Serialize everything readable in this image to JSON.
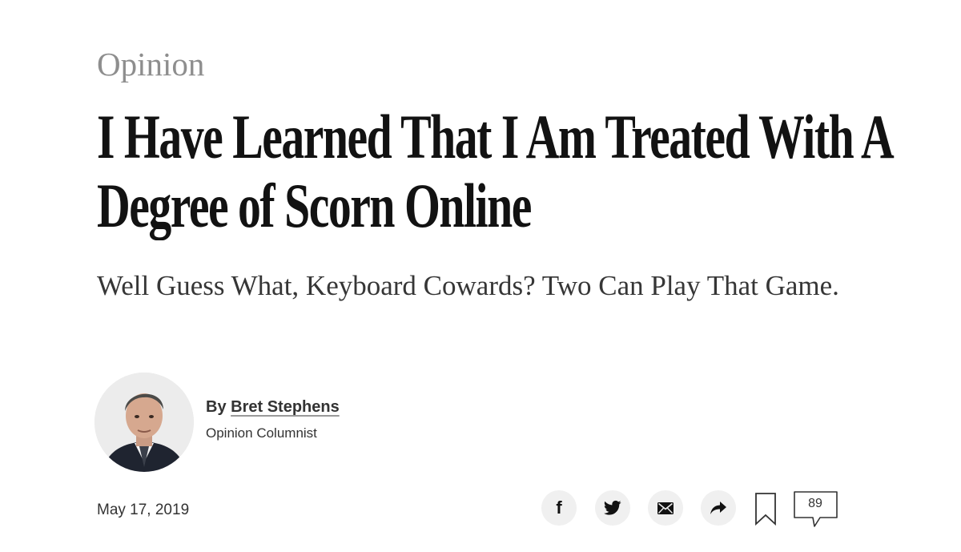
{
  "article": {
    "kicker": "Opinion",
    "headline": "I Have Learned That I Am Treated With A Degree of Scorn Online",
    "summary": "Well Guess What, Keyboard Cowards? Two Can Play That Game.",
    "byline_prefix": "By",
    "author": "Bret Stephens",
    "author_role": "Opinion Columnist",
    "date": "May 17, 2019"
  },
  "share": {
    "buttons": [
      {
        "icon": "facebook-icon",
        "label": "f"
      },
      {
        "icon": "twitter-icon"
      },
      {
        "icon": "email-icon"
      },
      {
        "icon": "share-arrow-icon"
      }
    ],
    "comment_count": "89"
  },
  "colors": {
    "text": "#121212",
    "kicker": "#8e8e8e",
    "button_bg": "#f0f0f0"
  }
}
